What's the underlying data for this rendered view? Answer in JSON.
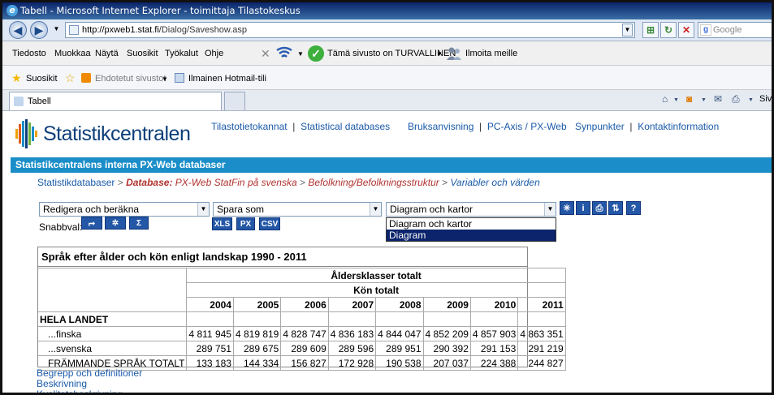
{
  "window": {
    "title": "Tabell - Microsoft Internet Explorer - toimittaja Tilastokeskus"
  },
  "address": {
    "url_host": "http://pxweb1.stat.fi",
    "url_path": "/Dialog/Saveshow.asp",
    "search_placeholder": "Google"
  },
  "menu": {
    "items": [
      "Tiedosto",
      "Muokkaa",
      "Näytä",
      "Suosikit",
      "Työkalut",
      "Ohje"
    ],
    "safety_text": "Tämä sivusto on TURVALLINEN",
    "report_text": "Ilmoita meille"
  },
  "favorites": {
    "favorites_label": "Suosikit",
    "suggested_label": "Ehdotetut sivustot",
    "hotmail_label": "Ilmainen Hotmail-tili"
  },
  "tabs": {
    "active_label": "Tabell",
    "cmd_partial": "Sivu"
  },
  "header": {
    "logo_text": "Statistikcentralen",
    "links": [
      {
        "label": "Tilastotietokannat"
      },
      {
        "label": "Statistical databases"
      },
      {
        "label": "Bruksanvisning"
      },
      {
        "label": "PC-Axis / PX-Web"
      },
      {
        "label": "Synpunkter"
      },
      {
        "label": "Kontaktinformation"
      }
    ]
  },
  "banner": {
    "title": "Statistikcentralens interna PX-Web databaser"
  },
  "breadcrumb": {
    "part1": "Statistikdatabaser",
    "part2_label": "Database:",
    "part2_value": "PX-Web StatFin på svenska",
    "part3": "Befolkning/Befolkningsstruktur",
    "part4": "Variabler och värden"
  },
  "controls": {
    "edit_select": "Redigera och beräkna",
    "save_select": "Spara som",
    "chart_select": "Diagram och kartor",
    "dropdown_options": [
      "Diagram och kartor",
      "Diagram"
    ],
    "dropdown_selected_index": 1,
    "quick_label": "Snabbval:",
    "quick_buttons": [
      "XLS",
      "PX",
      "CSV"
    ],
    "sigma": "Σ",
    "icons": [
      "settings-icon",
      "info-icon",
      "print-icon",
      "sort-icon",
      "help-icon"
    ]
  },
  "table": {
    "title": "Språk efter ålder och kön enligt landskap 1990 - 2011",
    "header_age": "Åldersklasser totalt",
    "header_sex": "Kön totalt",
    "years": [
      "2004",
      "2005",
      "2006",
      "2007",
      "2008",
      "2009",
      "2010",
      "2011"
    ],
    "region": "HELA LANDET",
    "rows": [
      {
        "label": "...finska",
        "values": [
          "4 811 945",
          "4 819 819",
          "4 828 747",
          "4 836 183",
          "4 844 047",
          "4 852 209",
          "4 857 903",
          "4 863 351"
        ]
      },
      {
        "label": "...svenska",
        "values": [
          "289 751",
          "289 675",
          "289 609",
          "289 596",
          "289 951",
          "290 392",
          "291 153",
          "291 219"
        ]
      },
      {
        "label": "FRÄMMANDE SPRÅK TOTALT",
        "values": [
          "133 183",
          "144 334",
          "156 827",
          "172 928",
          "190 538",
          "207 037",
          "224 388",
          "244 827"
        ]
      }
    ]
  },
  "footer_links": [
    "Begrepp och definitioner",
    "Beskrivning",
    "Kvalitetsbeskrivning"
  ],
  "colors": {
    "banner": "#1b8ec9",
    "link": "#1a5aa8",
    "selected_option": "#0b246b",
    "crumb_red": "#b0322f"
  }
}
